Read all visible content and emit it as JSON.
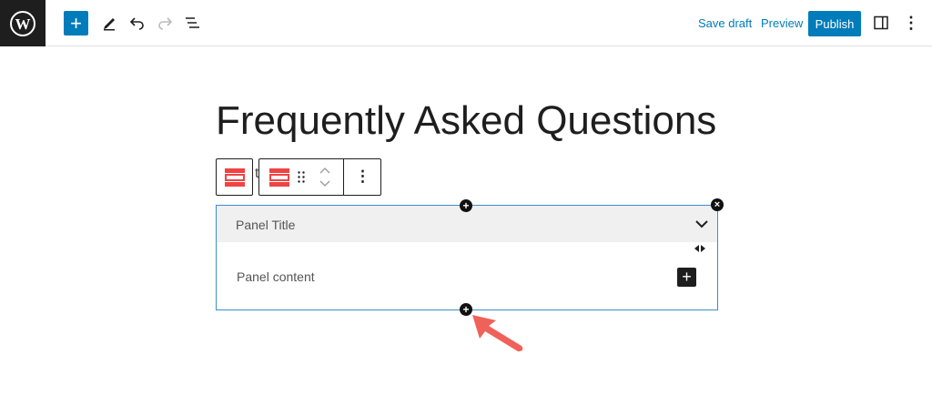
{
  "header": {
    "save_draft": "Save draft",
    "preview": "Preview",
    "publish": "Publish"
  },
  "page": {
    "title": "Frequently Asked Questions"
  },
  "toolbar": {
    "stray_char": "t"
  },
  "accordion": {
    "panel_title": "Panel Title",
    "panel_content": "Panel content"
  },
  "colors": {
    "accent": "#007cba",
    "block_icon": "#ef4444",
    "arrow": "#f0615a"
  }
}
